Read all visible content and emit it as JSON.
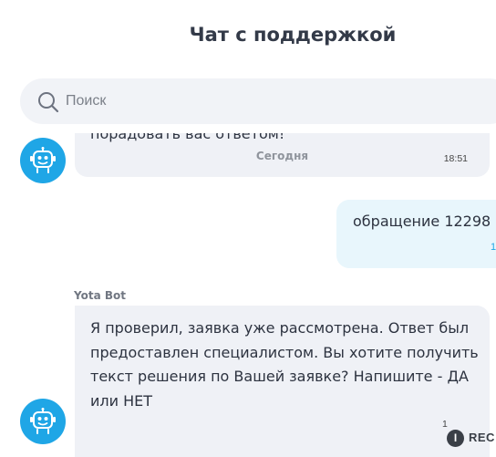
{
  "header": {
    "title": "Чат с поддержкой"
  },
  "search": {
    "placeholder": "Поиск",
    "icon": "search-icon"
  },
  "messages": [
    {
      "direction": "incoming",
      "text": "порадовать вас ответом!",
      "day_label": "Сегодня",
      "time": "18:51"
    },
    {
      "direction": "outgoing",
      "text": "обращение 12298",
      "time": "1"
    },
    {
      "direction": "incoming",
      "sender": "Yota Bot",
      "text": "Я проверил, заявка уже рассмотрена. Ответ был предоставлен специалистом. Вы хотите получить текст решения по Вашей заявке? Напишите - ДА или НЕТ",
      "time": "1"
    }
  ],
  "watermark": {
    "badge": "I",
    "text": "REC"
  },
  "colors": {
    "accent": "#1fa6e6",
    "incoming_bubble": "#eff1f6",
    "outgoing_bubble": "#e8f6fc"
  }
}
